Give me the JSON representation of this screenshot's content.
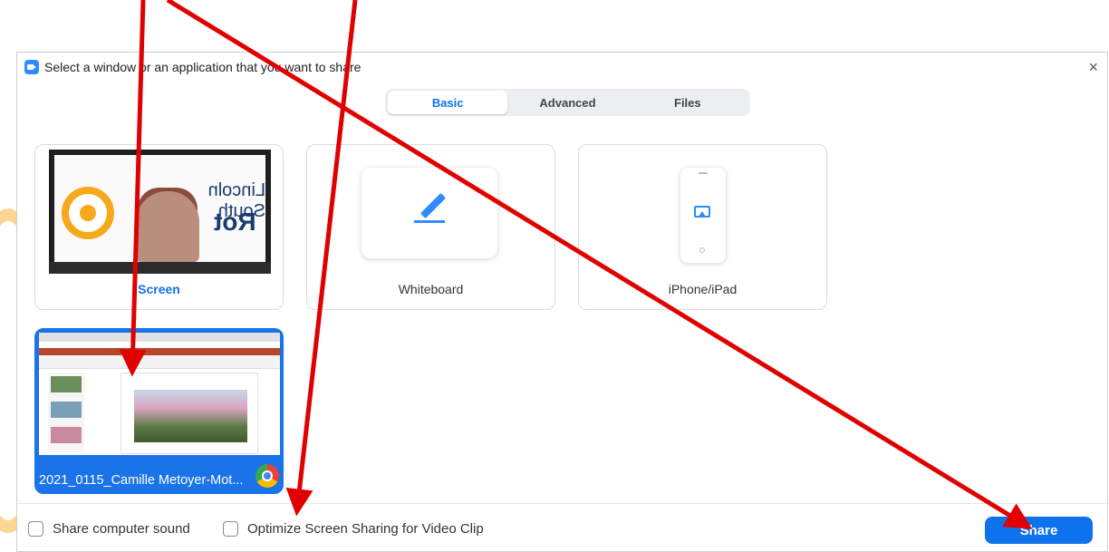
{
  "dialog": {
    "title": "Select a window or an application that you want to share",
    "close_icon": "×"
  },
  "tabs": [
    {
      "label": "Basic",
      "active": true
    },
    {
      "label": "Advanced",
      "active": false
    },
    {
      "label": "Files",
      "active": false
    }
  ],
  "tiles": {
    "screen": {
      "label": "Screen",
      "thumb_text_line1": "Lincoln South",
      "thumb_text_line2": "Rot"
    },
    "whiteboard": {
      "label": "Whiteboard"
    },
    "iphone": {
      "label": "iPhone/iPad"
    },
    "window": {
      "label": "2021_0115_Camille Metoyer-Mot..."
    }
  },
  "footer": {
    "share_sound_label": "Share computer sound",
    "optimize_label": "Optimize Screen Sharing for Video Clip",
    "share_button_label": "Share"
  },
  "colors": {
    "accent": "#0e72ed",
    "arrow": "#e00000",
    "selected_tile": "#1a73e8"
  }
}
